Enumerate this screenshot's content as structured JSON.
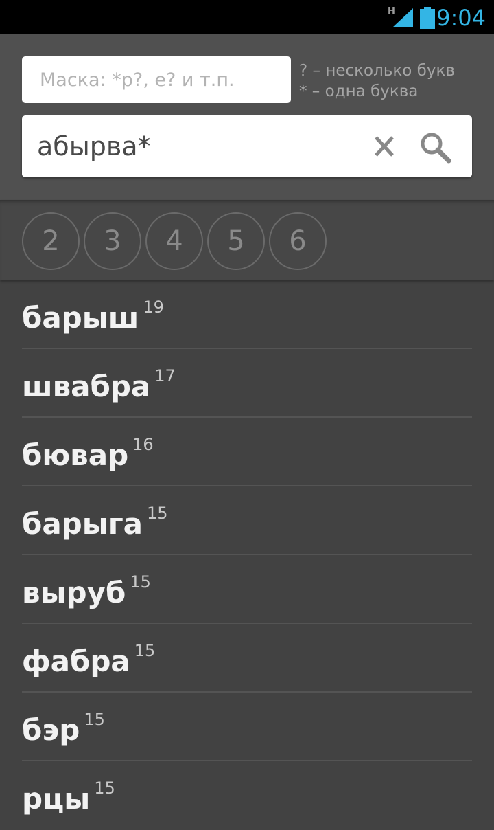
{
  "status_bar": {
    "network_type": "H",
    "time": "9:04",
    "accent_color": "#33b5e5"
  },
  "search": {
    "mask_placeholder": "Маска: *р?, е? и т.п.",
    "mask_value": "",
    "hint_line1": "? – несколько букв",
    "hint_line2": "* – одна буква",
    "query_value": "абырва*",
    "clear_icon": "close-icon",
    "search_icon": "search-icon"
  },
  "length_filters": [
    "2",
    "3",
    "4",
    "5",
    "6"
  ],
  "results": [
    {
      "word": "барыш",
      "score": "19"
    },
    {
      "word": "швабра",
      "score": "17"
    },
    {
      "word": "бювар",
      "score": "16"
    },
    {
      "word": "барыга",
      "score": "15"
    },
    {
      "word": "выруб",
      "score": "15"
    },
    {
      "word": "фабра",
      "score": "15"
    },
    {
      "word": "бэр",
      "score": "15"
    },
    {
      "word": "рцы",
      "score": "15"
    }
  ]
}
